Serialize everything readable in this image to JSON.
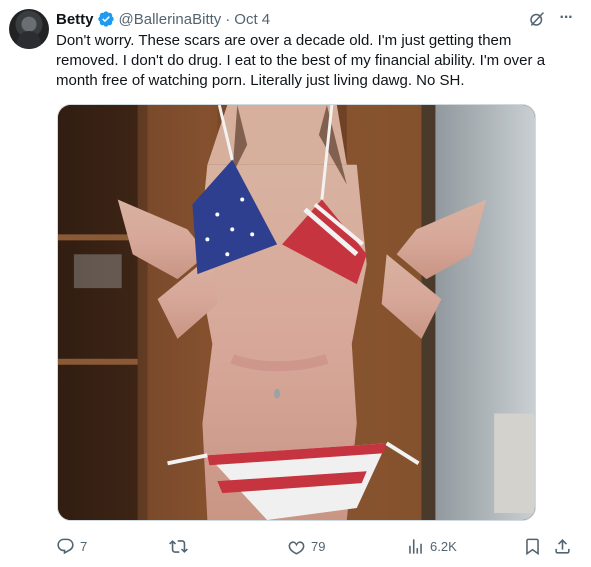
{
  "tweet": {
    "author_name": "Betty",
    "handle": "@BallerinaBitty",
    "separator": "·",
    "date": "Oct 4",
    "more_glyph": "···",
    "text": "Don't worry. These scars are over a decade old. I'm just getting them removed. I don't do drug. I eat to the best of my financial ability. I'm over a month free of watching porn. Literally just living dawg. No SH.",
    "media_alt": "photo"
  },
  "actions": {
    "reply_count": "7",
    "retweet_count": "",
    "like_count": "79",
    "views_count": "6.2K"
  },
  "colors": {
    "verified_blue": "#1d9bf0",
    "text_primary": "#0f1419",
    "text_secondary": "#536471",
    "border": "#cfd9de"
  },
  "icons": [
    "verified-badge-icon",
    "grok-icon",
    "more-icon",
    "reply-icon",
    "retweet-icon",
    "like-icon",
    "views-icon",
    "bookmark-icon",
    "share-icon"
  ]
}
